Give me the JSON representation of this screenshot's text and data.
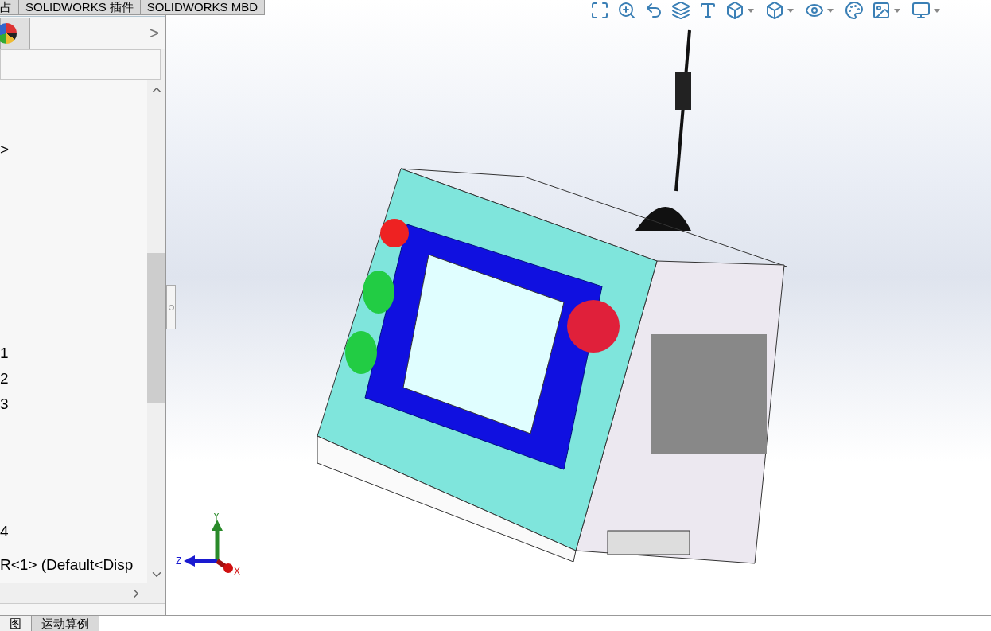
{
  "command_tabs": [
    {
      "label": "占",
      "selected": false
    },
    {
      "label": "SOLIDWORKS 插件",
      "selected": false
    },
    {
      "label": "SOLIDWORKS MBD",
      "selected": false
    }
  ],
  "panel": {
    "expand_glyph": ">"
  },
  "tree": {
    "items": [
      {
        "label": ">"
      },
      {
        "label": "1"
      },
      {
        "label": "2"
      },
      {
        "label": "3"
      },
      {
        "label": "4"
      },
      {
        "label": "R<1> (Default<Disp"
      }
    ]
  },
  "bottom_tabs": [
    {
      "label": "图",
      "selected": true
    },
    {
      "label": "运动算例",
      "selected": false
    }
  ],
  "triad": {
    "x": "X",
    "y": "Y",
    "z": "Z"
  }
}
